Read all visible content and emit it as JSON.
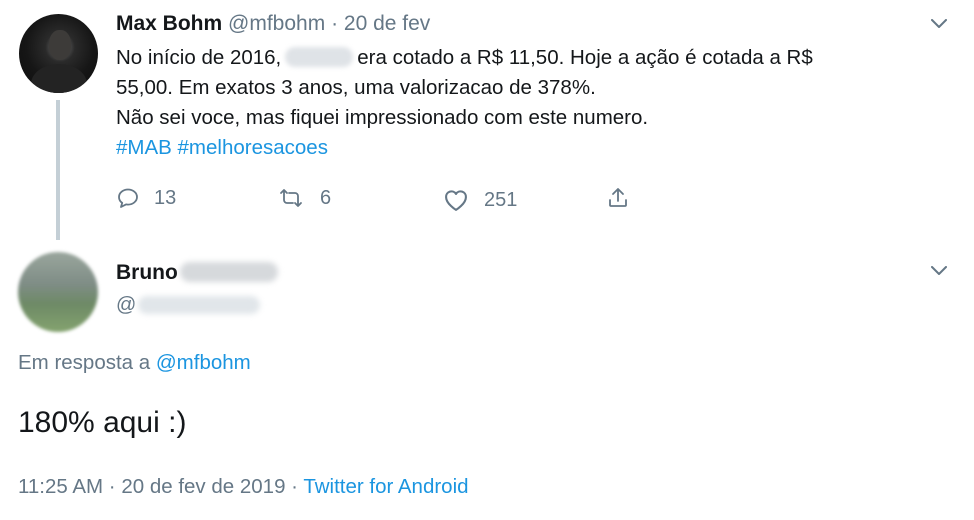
{
  "tweet": {
    "author_name": "Max Bohm",
    "author_handle": "@mfbohm",
    "separator": "·",
    "date": "20 de fev",
    "line1_before": "No início de 2016,",
    "line1_after": "era cotado a R$ 11,50. Hoje a ação é cotada a R$",
    "line2": "55,00. Em exatos 3 anos, uma valorizacao de 378%.",
    "line3": "Não sei voce, mas fiquei impressionado com este numero.",
    "hashtag1": "#MAB",
    "hashtag2": "#melhoresacoes",
    "actions": {
      "replies": "13",
      "retweets": "6",
      "likes": "251"
    }
  },
  "reply": {
    "author_name": "Bruno",
    "handle_prefix": "@",
    "in_reply_to_label": "Em resposta a",
    "in_reply_to_handle": "@mfbohm",
    "text": "180% aqui :)",
    "time": "11:25 AM",
    "separator": "·",
    "date": "20 de fev de 2019",
    "meta_separator": "·",
    "source": "Twitter for Android"
  },
  "icons": {
    "reply": "reply-bubble-icon",
    "retweet": "retweet-icon",
    "like": "heart-icon",
    "share": "share-icon",
    "menu": "chevron-down-icon"
  },
  "colors": {
    "text": "#14171a",
    "muted": "#657786",
    "link": "#1b95e0",
    "thread_line": "#c4cfd6"
  }
}
